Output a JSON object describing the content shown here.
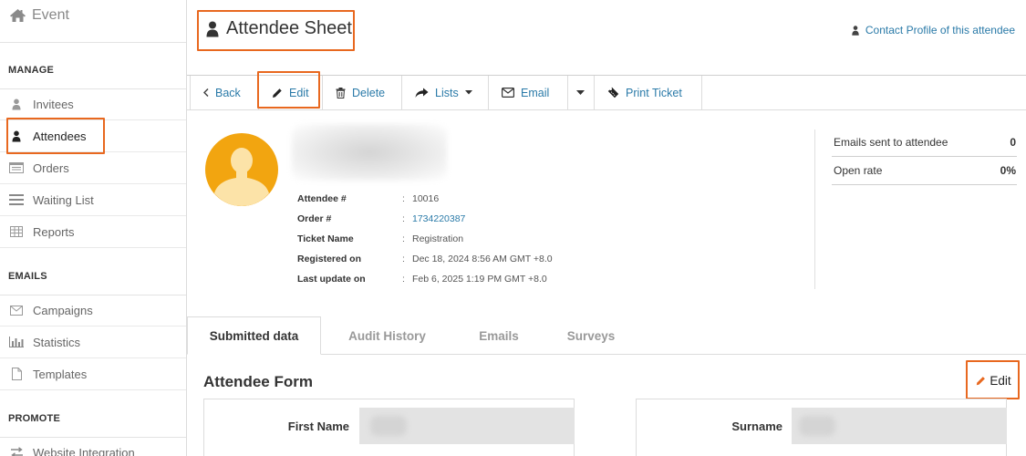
{
  "sidebar": {
    "brand": "Event",
    "sections": {
      "manage": "MANAGE",
      "emails": "EMAILS",
      "promote": "PROMOTE"
    },
    "items": {
      "invitees": "Invitees",
      "attendees": "Attendees",
      "orders": "Orders",
      "waiting_list": "Waiting List",
      "reports": "Reports",
      "campaigns": "Campaigns",
      "statistics": "Statistics",
      "templates": "Templates",
      "website_integration": "Website Integration"
    },
    "active_item": "Attendees"
  },
  "header": {
    "title": "Attendee Sheet",
    "contact_link": "Contact Profile of this attendee"
  },
  "toolbar": {
    "back": "Back",
    "edit": "Edit",
    "delete": "Delete",
    "lists": "Lists",
    "email": "Email",
    "print_ticket": "Print Ticket"
  },
  "attendee": {
    "details": {
      "attendee_no_label": "Attendee #",
      "attendee_no": "10016",
      "order_no_label": "Order #",
      "order_no": "1734220387",
      "ticket_name_label": "Ticket Name",
      "ticket_name": "Registration",
      "registered_on_label": "Registered on",
      "registered_on": "Dec 18, 2024 8:56 AM GMT +8.0",
      "last_update_label": "Last update on",
      "last_update": "Feb 6, 2025 1:19 PM GMT +8.0",
      "separator": ":"
    },
    "stats": {
      "emails_sent_label": "Emails sent to attendee",
      "emails_sent": "0",
      "open_rate_label": "Open rate",
      "open_rate": "0%"
    }
  },
  "tabs": {
    "submitted_data": "Submitted data",
    "audit_history": "Audit History",
    "emails": "Emails",
    "surveys": "Surveys",
    "active": "Submitted data"
  },
  "form": {
    "title": "Attendee Form",
    "edit_label": "Edit",
    "first_name_label": "First Name",
    "surname_label": "Surname"
  },
  "colors": {
    "accent_link": "#2a7aa8",
    "highlight_outline": "#e8681f",
    "avatar_background": "#f2a510"
  }
}
